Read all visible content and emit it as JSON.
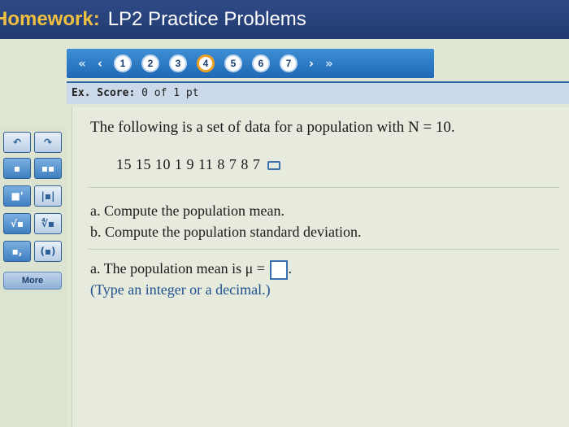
{
  "header": {
    "label": "Homework:",
    "assignment": "LP2 Practice Problems"
  },
  "nav": {
    "first_arrow": "«",
    "prev_arrow": "‹",
    "next_arrow": "›",
    "last_arrow": "»",
    "questions": [
      "1",
      "2",
      "3",
      "4",
      "5",
      "6",
      "7"
    ],
    "current_question": "4"
  },
  "score": {
    "label": "Ex. Score:",
    "value": "0 of 1 pt"
  },
  "toolbar": {
    "more_label": "More"
  },
  "problem": {
    "intro": "The following is a set of data for a population with N = 10.",
    "dataset": "15  15  10  1  9  11  8  7  8  7",
    "task_a": "a. Compute the population mean.",
    "task_b": "b. Compute the population standard deviation.",
    "answer_prompt": "a. The population mean is μ =",
    "answer_value": "",
    "answer_suffix": ".",
    "hint": "(Type an integer or a decimal.)"
  },
  "colors": {
    "title_bar": "#223a70",
    "label_accent": "#f0c040",
    "nav_bar": "#1f68b5",
    "current_ring": "#f0a020"
  }
}
